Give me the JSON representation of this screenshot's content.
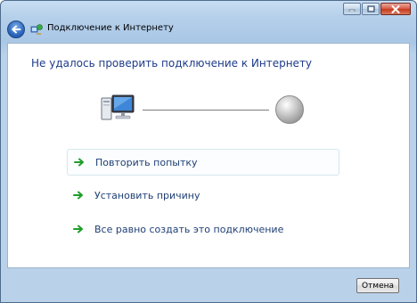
{
  "window": {
    "title": "Подключение к Интернету",
    "controls": [
      "minimize",
      "maximize",
      "close"
    ]
  },
  "content": {
    "heading": "Не удалось проверить подключение к Интернету",
    "diagram": {
      "left_icon": "computer-icon",
      "right_icon": "globe-icon"
    },
    "options": [
      {
        "label": "Повторить попытку",
        "icon": "green-arrow-icon",
        "selected": true
      },
      {
        "label": "Установить причину",
        "icon": "green-arrow-icon",
        "selected": false
      },
      {
        "label": "Все равно создать это подключение",
        "icon": "green-arrow-icon",
        "selected": false
      }
    ]
  },
  "footer": {
    "cancel_label": "Отмена"
  },
  "colors": {
    "heading": "#1e3b8a",
    "option_text": "#1f3f75",
    "arrow": "#1f9e2a",
    "frame": "#b4cfea"
  }
}
